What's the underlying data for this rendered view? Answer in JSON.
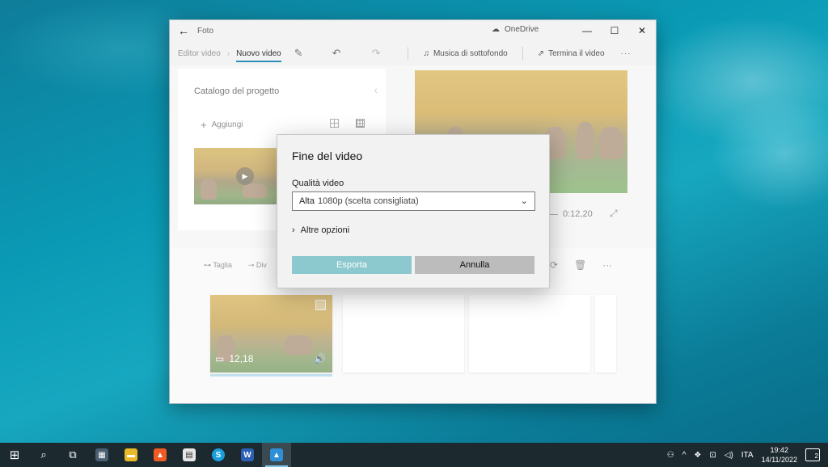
{
  "window": {
    "title": "Foto",
    "onedrive_label": "OneDrive",
    "controls": [
      "—",
      "☐",
      "✕"
    ]
  },
  "toolbar": {
    "breadcrumb_parent": "Editor video",
    "breadcrumb_current": "Nuovo video",
    "background_music": "Musica di sottofondo",
    "finish_video": "Termina il video",
    "more": "···"
  },
  "catalog": {
    "title": "Catalogo del progetto",
    "add_label": "Aggiungi"
  },
  "preview": {
    "time": "0:12,20"
  },
  "storyboard": {
    "tools": [
      "Taglia",
      "Div"
    ],
    "clip": {
      "duration": "12,18"
    }
  },
  "dialog": {
    "title": "Fine del video",
    "quality_label": "Qualità video",
    "quality_value_strong": "Alta",
    "quality_value_detail": "1080p (scelta consigliata)",
    "more_options": "Altre opzioni",
    "export_button": "Esporta",
    "cancel_button": "Annulla"
  },
  "taskbar": {
    "language": "ITA",
    "time": "19:42",
    "date": "14/11/2022",
    "notification_count": "2"
  },
  "colors": {
    "accent": "#2a8fb5",
    "export_button": "#8cc9cf",
    "cancel_button": "#bcbcbc",
    "taskbar": "#1c2a30"
  }
}
